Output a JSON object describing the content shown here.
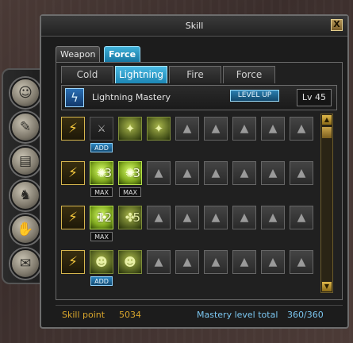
{
  "window": {
    "title": "Skill",
    "close_label": "X"
  },
  "weapon_tabs": [
    {
      "label": "Weapon"
    },
    {
      "label": "Force"
    }
  ],
  "element_tabs": [
    {
      "label": "Cold"
    },
    {
      "label": "Lightning"
    },
    {
      "label": "Fire"
    },
    {
      "label": "Force"
    }
  ],
  "mastery": {
    "name": "Lightning Mastery",
    "level_up_label": "LEVEL UP",
    "level": "Lv 45"
  },
  "rows": [
    {
      "skills": [
        {
          "kind": "cat",
          "icon": "⚡"
        },
        {
          "kind": "dim",
          "icon": "⚔",
          "tag": "ADD"
        },
        {
          "kind": "green",
          "icon": "✦"
        },
        {
          "kind": "green",
          "icon": "✦"
        },
        {
          "kind": "lock",
          "icon": "▲"
        },
        {
          "kind": "lock",
          "icon": "▲"
        },
        {
          "kind": "lock",
          "icon": "▲"
        },
        {
          "kind": "lock",
          "icon": "▲"
        },
        {
          "kind": "lock",
          "icon": "▲"
        }
      ]
    },
    {
      "skills": [
        {
          "kind": "cat",
          "icon": "⚡"
        },
        {
          "kind": "greenhi",
          "icon": "✺",
          "count": "3",
          "tag": "MAX"
        },
        {
          "kind": "greenhi",
          "icon": "✺",
          "count": "3",
          "tag": "MAX"
        },
        {
          "kind": "lock",
          "icon": "▲"
        },
        {
          "kind": "lock",
          "icon": "▲"
        },
        {
          "kind": "lock",
          "icon": "▲"
        },
        {
          "kind": "lock",
          "icon": "▲"
        },
        {
          "kind": "lock",
          "icon": "▲"
        },
        {
          "kind": "lock",
          "icon": "▲"
        }
      ]
    },
    {
      "skills": [
        {
          "kind": "cat",
          "icon": "⚡"
        },
        {
          "kind": "greenhi",
          "icon": "✤",
          "count": "12",
          "tag": "MAX"
        },
        {
          "kind": "green",
          "icon": "✤",
          "count": "5"
        },
        {
          "kind": "lock",
          "icon": "▲"
        },
        {
          "kind": "lock",
          "icon": "▲"
        },
        {
          "kind": "lock",
          "icon": "▲"
        },
        {
          "kind": "lock",
          "icon": "▲"
        },
        {
          "kind": "lock",
          "icon": "▲"
        },
        {
          "kind": "lock",
          "icon": "▲"
        }
      ]
    },
    {
      "skills": [
        {
          "kind": "cat",
          "icon": "⚡"
        },
        {
          "kind": "green",
          "icon": "☻",
          "tag": "ADD"
        },
        {
          "kind": "green",
          "icon": "☻"
        },
        {
          "kind": "lock",
          "icon": "▲"
        },
        {
          "kind": "lock",
          "icon": "▲"
        },
        {
          "kind": "lock",
          "icon": "▲"
        },
        {
          "kind": "lock",
          "icon": "▲"
        },
        {
          "kind": "lock",
          "icon": "▲"
        },
        {
          "kind": "lock",
          "icon": "▲"
        }
      ]
    }
  ],
  "sidebar_icons": [
    "☺",
    "✎",
    "▤",
    "♞",
    "✋",
    "✉"
  ],
  "footer": {
    "skill_point_label": "Skill point",
    "skill_point_value": "5034",
    "mastery_total_label": "Mastery level total",
    "mastery_total_value": "360/360"
  },
  "colors": {
    "accent": "#1c86b4",
    "gold": "#d8a52c",
    "blue_text": "#7bc6f0"
  }
}
